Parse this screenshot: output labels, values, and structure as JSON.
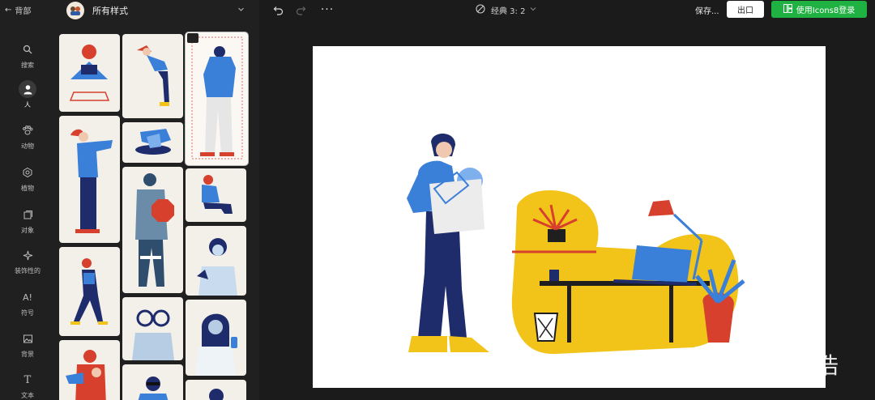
{
  "rail": {
    "back_label": "背部",
    "items": [
      {
        "label": "搜索",
        "icon": "search-icon"
      },
      {
        "label": "人",
        "icon": "person-icon"
      },
      {
        "label": "动物",
        "icon": "paw-icon"
      },
      {
        "label": "植物",
        "icon": "flower-icon"
      },
      {
        "label": "对象",
        "icon": "object-icon"
      },
      {
        "label": "装饰性的",
        "icon": "sparkle-icon"
      },
      {
        "label": "符号",
        "icon": "symbol-icon"
      },
      {
        "label": "背景",
        "icon": "image-icon"
      },
      {
        "label": "文本",
        "icon": "text-icon"
      }
    ]
  },
  "panel": {
    "style_label": "所有样式"
  },
  "topbar": {
    "ratio_label": "经典 3: 2",
    "saving_label": "保存...",
    "export_label": "出口",
    "login_label": "使用Icons8登录"
  },
  "watermark": "知乎 @李天浩",
  "colors": {
    "accent_green": "#1fb141",
    "illustration_blue": "#3a7fd8",
    "illustration_navy": "#1f2c6b",
    "illustration_yellow": "#f2c318",
    "illustration_red": "#d6402d"
  }
}
